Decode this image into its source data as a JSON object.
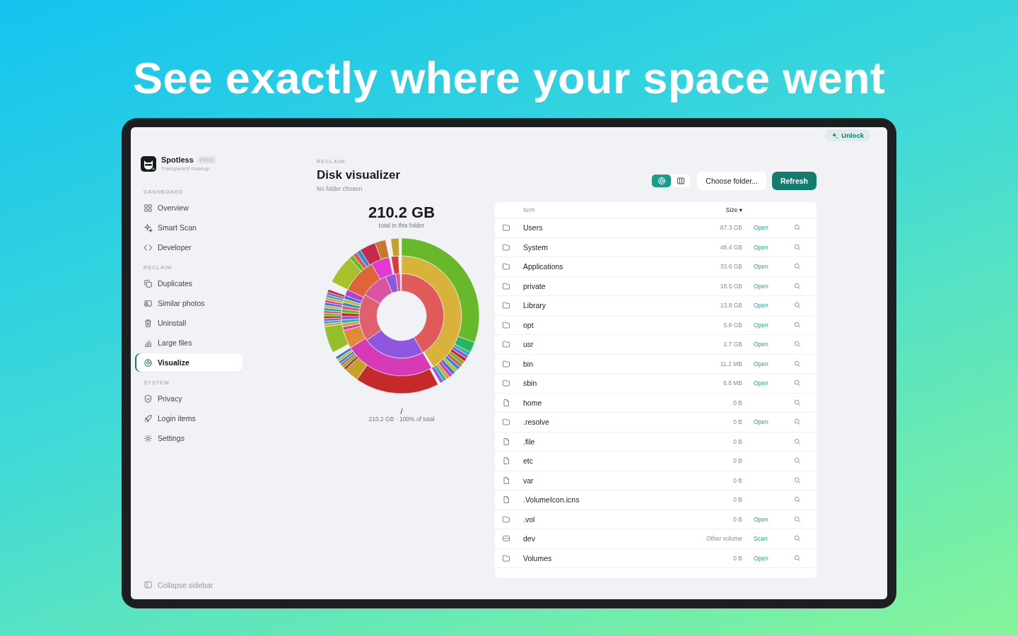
{
  "headline": "See exactly where your space went",
  "app": {
    "name": "Spotless",
    "badge": "FREE",
    "tagline": "Transparent cleanup"
  },
  "unlock": "Unlock",
  "sidebar": {
    "sections": [
      {
        "label": "DASHBOARD",
        "items": [
          {
            "label": "Overview",
            "selected": false
          },
          {
            "label": "Smart Scan",
            "selected": false
          },
          {
            "label": "Developer",
            "selected": false
          }
        ]
      },
      {
        "label": "RECLAIM",
        "items": [
          {
            "label": "Duplicates",
            "selected": false
          },
          {
            "label": "Similar photos",
            "selected": false
          },
          {
            "label": "Uninstall",
            "selected": false
          },
          {
            "label": "Large files",
            "selected": false
          },
          {
            "label": "Visualize",
            "selected": true
          }
        ]
      },
      {
        "label": "SYSTEM",
        "items": [
          {
            "label": "Privacy",
            "selected": false
          },
          {
            "label": "Login items",
            "selected": false
          },
          {
            "label": "Settings",
            "selected": false
          }
        ]
      }
    ],
    "footer": "Collapse sidebar"
  },
  "header": {
    "eyebrow": "RECLAIM",
    "title": "Disk visualizer",
    "subtitle": "No folder chosen"
  },
  "view_toggle": [
    {
      "kind": "sunburst",
      "selected": true
    },
    {
      "kind": "columns",
      "selected": false
    }
  ],
  "buttons": [
    {
      "label": "Choose folder...",
      "kind": "secondary"
    },
    {
      "label": "Refresh",
      "kind": "primary"
    }
  ],
  "summary": {
    "total": "210.2 GB",
    "caption": "total in this folder",
    "path": "/",
    "detail": "210.2 GB · 100% of total"
  },
  "table": {
    "columns": [
      "Item",
      "Size ▾"
    ],
    "rows": [
      {
        "kind": "folder",
        "name": "Users",
        "size": "87.3 GB",
        "action": "Open"
      },
      {
        "kind": "folder",
        "name": "System",
        "size": "48.4 GB",
        "action": "Open"
      },
      {
        "kind": "folder",
        "name": "Applications",
        "size": "33.6 GB",
        "action": "Open"
      },
      {
        "kind": "folder",
        "name": "private",
        "size": "18.5 GB",
        "action": "Open"
      },
      {
        "kind": "folder",
        "name": "Library",
        "size": "13.8 GB",
        "action": "Open"
      },
      {
        "kind": "folder",
        "name": "opt",
        "size": "5.9 GB",
        "action": "Open"
      },
      {
        "kind": "folder",
        "name": "usr",
        "size": "2.7 GB",
        "action": "Open"
      },
      {
        "kind": "folder",
        "name": "bin",
        "size": "11.2 MB",
        "action": "Open"
      },
      {
        "kind": "folder",
        "name": "sbin",
        "size": "8.8 MB",
        "action": "Open"
      },
      {
        "kind": "file",
        "name": "home",
        "size": "0 B"
      },
      {
        "kind": "folder",
        "name": ".resolve",
        "size": "0 B",
        "action": "Open"
      },
      {
        "kind": "file",
        "name": ".file",
        "size": "0 B"
      },
      {
        "kind": "file",
        "name": "etc",
        "size": "0 B"
      },
      {
        "kind": "file",
        "name": "var",
        "size": "0 B"
      },
      {
        "kind": "file",
        "name": ".VolumeIcon.icns",
        "size": "0 B"
      },
      {
        "kind": "folder",
        "name": ".vol",
        "size": "0 B",
        "action": "Open"
      },
      {
        "kind": "volume",
        "name": "dev",
        "size": "Other volume",
        "action": "Scan"
      },
      {
        "kind": "folder",
        "name": "Volumes",
        "size": "0 B",
        "action": "Open"
      }
    ]
  }
}
